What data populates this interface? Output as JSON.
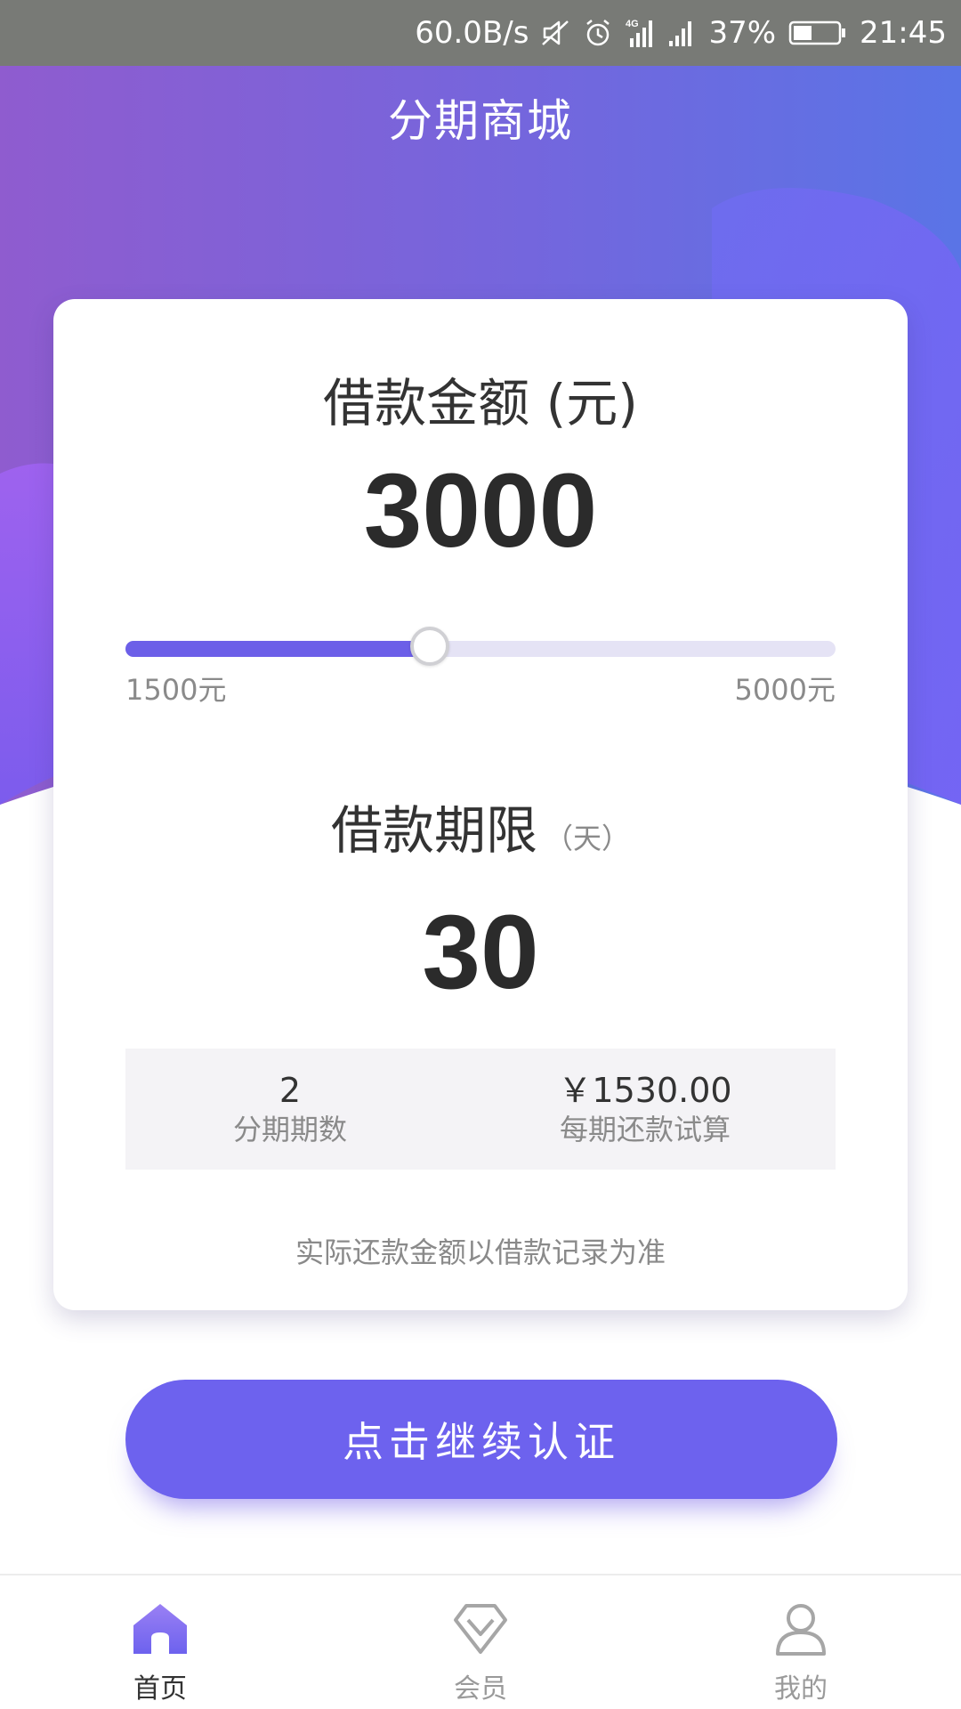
{
  "status_bar": {
    "network_speed": "60.0B/s",
    "battery_percent": "37%",
    "time": "21:45",
    "icons": [
      "mute-vibrate-icon",
      "alarm-icon",
      "signal-4g-icon",
      "signal-icon",
      "battery-icon"
    ]
  },
  "header": {
    "title": "分期商城"
  },
  "loan": {
    "amount_label": "借款金额 (元)",
    "amount_value": "3000",
    "slider": {
      "min_label": "1500元",
      "max_label": "5000元",
      "min": 1500,
      "max": 5000,
      "value": 3000
    },
    "term_label": "借款期限",
    "term_unit": "（天）",
    "term_value": "30",
    "summary": {
      "installments_value": "2",
      "installments_label": "分期期数",
      "payment_value": "￥1530.00",
      "payment_label": "每期还款试算"
    },
    "disclaimer": "实际还款金额以借款记录为准"
  },
  "cta": {
    "label": "点击继续认证"
  },
  "tab_bar": {
    "items": [
      {
        "label": "首页",
        "icon": "home-icon",
        "active": true
      },
      {
        "label": "会员",
        "icon": "diamond-icon",
        "active": false
      },
      {
        "label": "我的",
        "icon": "profile-icon",
        "active": false
      }
    ]
  },
  "colors": {
    "accent": "#6d62ee",
    "hero_gradient_start": "#8f5ccf",
    "hero_gradient_end": "#5a74e6",
    "status_bar": "#787a76"
  }
}
